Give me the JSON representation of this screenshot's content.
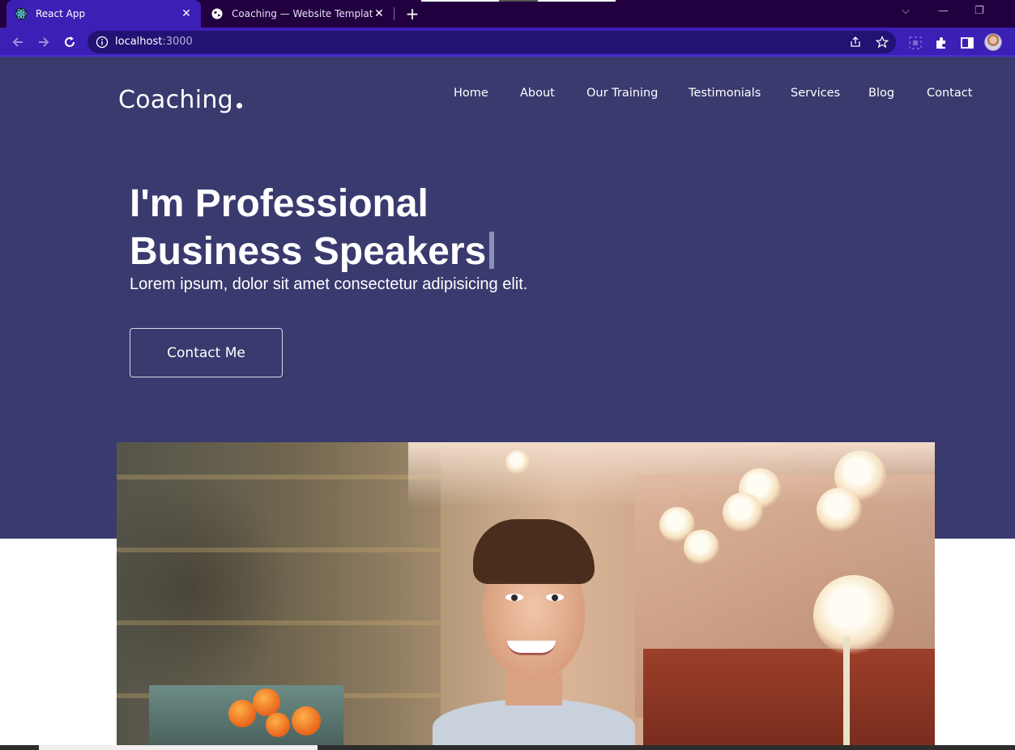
{
  "browser": {
    "tabs": [
      {
        "title": "React App",
        "icon": "react-icon",
        "active": true
      },
      {
        "title": "Coaching — Website Template b",
        "icon": "globe-icon",
        "active": false
      }
    ],
    "new_tab_label": "+",
    "address": {
      "host": "localhost",
      "port": ":3000"
    },
    "colors": {
      "tabstrip": "#22003f",
      "toolbar": "#3c1fb5",
      "omnibox": "#221273"
    }
  },
  "site": {
    "brand": "Coaching",
    "nav": [
      {
        "label": "Home"
      },
      {
        "label": "About"
      },
      {
        "label": "Our Training"
      },
      {
        "label": "Testimonials"
      },
      {
        "label": "Services"
      },
      {
        "label": "Blog"
      },
      {
        "label": "Contact"
      }
    ],
    "hero": {
      "headline_line1": "I'm Professional",
      "headline_line2": "Business Speakers",
      "subtitle": "Lorem ipsum, dolor sit amet consectetur adipisicing elit.",
      "cta_label": "Contact Me",
      "photo_icon": "portrait-photo"
    },
    "colors": {
      "hero_background": "#393a6e",
      "text": "#ffffff"
    }
  }
}
